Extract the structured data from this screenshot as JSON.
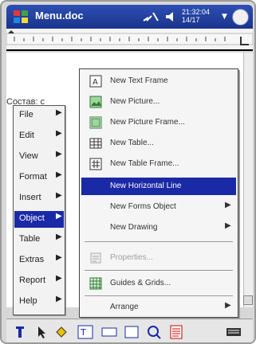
{
  "titlebar": {
    "app_title": "Menu.doc",
    "clock_time": "21:32:04",
    "clock_date": "14/17"
  },
  "document": {
    "visible_text": "Состав: с"
  },
  "object_menu": {
    "items": [
      {
        "label": "File"
      },
      {
        "label": "Edit"
      },
      {
        "label": "View"
      },
      {
        "label": "Format"
      },
      {
        "label": "Insert"
      },
      {
        "label": "Object"
      },
      {
        "label": "Table"
      },
      {
        "label": "Extras"
      },
      {
        "label": "Report"
      },
      {
        "label": "Help"
      }
    ]
  },
  "object_submenu": {
    "items": [
      {
        "label": "New Text Frame",
        "icon": "text-frame-icon"
      },
      {
        "label": "New Picture...",
        "icon": "picture-icon"
      },
      {
        "label": "New Picture Frame...",
        "icon": "picture-frame-icon"
      },
      {
        "label": "New Table...",
        "icon": "table-icon"
      },
      {
        "label": "New Table Frame...",
        "icon": "table-frame-icon"
      },
      {
        "label": "New Horizontal Line"
      },
      {
        "label": "New Forms Object"
      },
      {
        "label": "New Drawing"
      },
      {
        "label": "Properties...",
        "icon": "properties-icon"
      },
      {
        "label": "Guides & Grids...",
        "icon": "grid-icon"
      },
      {
        "label": "Arrange"
      }
    ]
  },
  "colors": {
    "selection": "#1a2aa6",
    "titlebar": "#2d4fb3"
  }
}
